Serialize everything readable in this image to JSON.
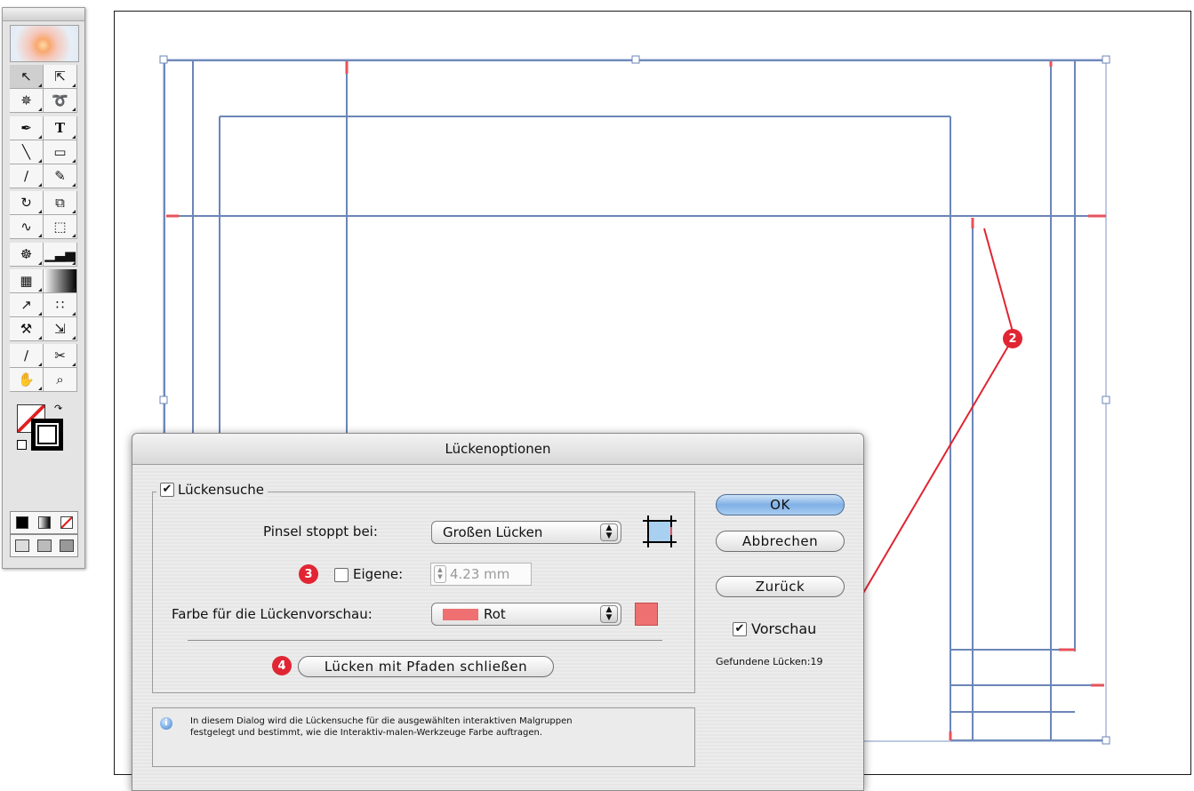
{
  "dialog": {
    "title": "Lückenoptionen",
    "gap_detection_label": "Lückensuche",
    "gap_detection_checked": true,
    "brush_stops_label": "Pinsel stoppt bei:",
    "brush_stops_value": "Großen Lücken",
    "custom_label": "Eigene:",
    "custom_checked": false,
    "custom_value": "4.23 mm",
    "color_label": "Farbe für die Lückenvorschau:",
    "color_value": "Rot",
    "close_gaps_button": "Lücken mit Pfaden schließen",
    "ok_button": "OK",
    "cancel_button": "Abbrechen",
    "reset_button": "Zurück",
    "preview_label": "Vorschau",
    "preview_checked": true,
    "gaps_found": "Gefundene Lücken:19",
    "info_text_1": "In diesem Dialog wird die Lückensuche für die ausgewählten interaktiven Malgruppen",
    "info_text_2": "festgelegt und bestimmt, wie die Interaktiv-malen-Werkzeuge Farbe auftragen."
  },
  "callouts": {
    "badge_2": "2",
    "badge_3": "3",
    "badge_4": "4"
  },
  "colors": {
    "path_blue": "#6b86b7",
    "gap_red": "#e8525a",
    "callout_red": "#e12532",
    "preview_swatch": "#ee7070"
  },
  "toolbox": {
    "tools": [
      "selection-tool",
      "direct-selection-tool",
      "magic-wand-tool",
      "lasso-tool",
      "pen-tool",
      "type-tool",
      "line-tool",
      "rectangle-tool",
      "paintbrush-tool",
      "pencil-tool",
      "rotate-tool",
      "scale-tool",
      "warp-tool",
      "free-transform-tool",
      "symbol-sprayer-tool",
      "column-graph-tool",
      "mesh-tool",
      "gradient-tool",
      "eyedropper-tool",
      "live-paint-bucket-tool",
      "live-paint-selection-tool",
      "slice-tool",
      "scissors-tool",
      "hand-tool",
      "zoom-tool"
    ]
  }
}
